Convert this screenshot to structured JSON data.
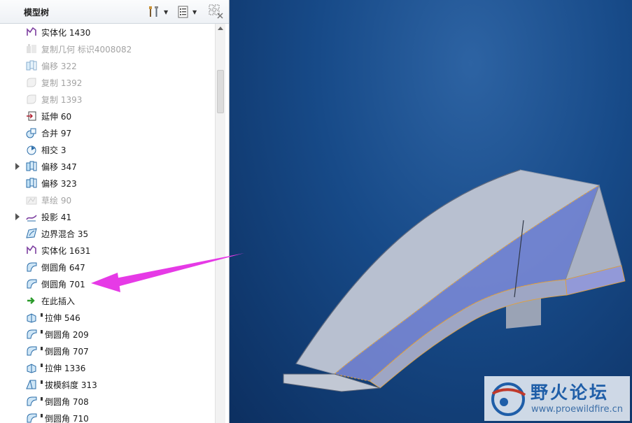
{
  "panel": {
    "title": "模型树",
    "settings_icon": "tools-icon",
    "show_icon": "list-icon",
    "grid_icon": "grid-icon"
  },
  "tree": {
    "items": [
      {
        "label": "实体化 1430",
        "icon": "solidify-icon",
        "dim": false,
        "expand": false,
        "badge": false
      },
      {
        "label": "复制几何 标识4008082",
        "icon": "copy-geom-icon",
        "dim": true,
        "expand": false,
        "badge": false
      },
      {
        "label": "偏移 322",
        "icon": "offset-icon",
        "dim": true,
        "expand": false,
        "badge": false
      },
      {
        "label": "复制 1392",
        "icon": "copy-icon",
        "dim": true,
        "expand": false,
        "badge": false
      },
      {
        "label": "复制 1393",
        "icon": "copy-icon",
        "dim": true,
        "expand": false,
        "badge": false
      },
      {
        "label": "延伸 60",
        "icon": "extend-icon",
        "dim": false,
        "expand": false,
        "badge": false
      },
      {
        "label": "合并 97",
        "icon": "merge-icon",
        "dim": false,
        "expand": false,
        "badge": false
      },
      {
        "label": "相交 3",
        "icon": "intersect-icon",
        "dim": false,
        "expand": false,
        "badge": false
      },
      {
        "label": "偏移 347",
        "icon": "offset-icon",
        "dim": false,
        "expand": true,
        "badge": false
      },
      {
        "label": "偏移 323",
        "icon": "offset-icon",
        "dim": false,
        "expand": false,
        "badge": false
      },
      {
        "label": "草绘 90",
        "icon": "sketch-icon",
        "dim": true,
        "expand": false,
        "badge": false
      },
      {
        "label": "投影 41",
        "icon": "project-icon",
        "dim": false,
        "expand": true,
        "badge": false
      },
      {
        "label": "边界混合 35",
        "icon": "boundary-blend-icon",
        "dim": false,
        "expand": false,
        "badge": false
      },
      {
        "label": "实体化 1631",
        "icon": "solidify-icon",
        "dim": false,
        "expand": false,
        "badge": false
      },
      {
        "label": "倒圆角 647",
        "icon": "round-icon",
        "dim": false,
        "expand": false,
        "badge": false
      },
      {
        "label": "倒圆角 701",
        "icon": "round-icon",
        "dim": false,
        "expand": false,
        "badge": false
      },
      {
        "label": "在此插入",
        "icon": "insert-here-icon",
        "dim": false,
        "expand": false,
        "badge": false
      },
      {
        "label": "拉伸 546",
        "icon": "extrude-icon",
        "dim": false,
        "expand": false,
        "badge": true
      },
      {
        "label": "倒圆角 209",
        "icon": "round-icon",
        "dim": false,
        "expand": false,
        "badge": true
      },
      {
        "label": "倒圆角 707",
        "icon": "round-icon",
        "dim": false,
        "expand": false,
        "badge": true
      },
      {
        "label": "拉伸 1336",
        "icon": "extrude-icon",
        "dim": false,
        "expand": false,
        "badge": true
      },
      {
        "label": "拔模斜度 313",
        "icon": "draft-icon",
        "dim": false,
        "expand": false,
        "badge": true
      },
      {
        "label": "倒圆角 708",
        "icon": "round-icon",
        "dim": false,
        "expand": false,
        "badge": true
      },
      {
        "label": "倒圆角 710",
        "icon": "round-icon",
        "dim": false,
        "expand": false,
        "badge": true
      }
    ]
  },
  "watermark": {
    "title": "野火论坛",
    "url": "www.proewildfire.cn"
  },
  "colors": {
    "arrow": "#e63ae6",
    "viewport_bg": "#174a88",
    "model_surface": "#a9b3c6",
    "edge_highlight": "#f0b040"
  }
}
